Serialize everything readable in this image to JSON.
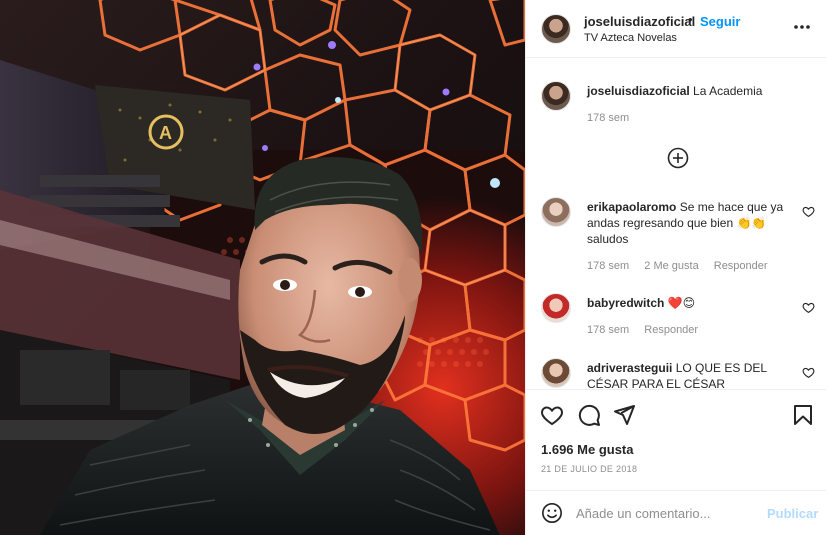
{
  "post": {
    "author": "joseluisdiazoficial",
    "follow_label": "Seguir",
    "separator": "•",
    "location": "TV Azteca Novelas",
    "photo_icon": "selfie-photo"
  },
  "caption": {
    "username": "joseluisdiazoficial",
    "text": "La Academia",
    "time": "178 sem"
  },
  "load_more_icon": "plus-circle-icon",
  "comments": [
    {
      "username": "erikapaolaromo",
      "text": "Se me hace que ya andas regresando que bien 👏👏 saludos",
      "time": "178 sem",
      "likes": "2 Me gusta",
      "reply": "Responder"
    },
    {
      "username": "babyredwitch",
      "text": "❤️😊",
      "time": "178 sem",
      "reply": "Responder"
    },
    {
      "username": "adriverasteguii",
      "text": "LO QUE ES DEL CÉSAR PARA EL CÉSAR",
      "time": "",
      "reply": ""
    }
  ],
  "actions": {
    "like_icon": "heart-icon",
    "comment_icon": "comment-icon",
    "share_icon": "paper-plane-icon",
    "save_icon": "bookmark-icon"
  },
  "likes_count": "1.696 Me gusta",
  "date": "21 DE JULIO DE 2018",
  "composer": {
    "placeholder": "Añade un comentario...",
    "publish_label": "Publicar"
  },
  "colors": {
    "link_blue": "#0095f6",
    "publish_disabled": "#b3dbff",
    "meta_gray": "#8e8e8e",
    "text": "#262626",
    "hex_light_orange": "#ff7a3c"
  }
}
